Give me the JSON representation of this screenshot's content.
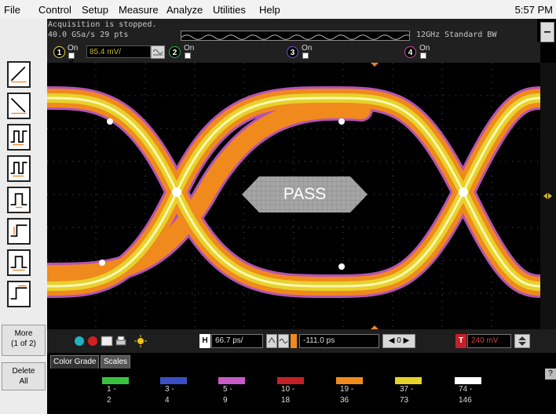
{
  "menu": {
    "items": [
      "File",
      "Control",
      "Setup",
      "Measure",
      "Analyze",
      "Utilities",
      "Help"
    ],
    "clock": "5:57 PM"
  },
  "status": {
    "line1": "Acquisition is stopped.",
    "line2": "40.0 GSa/s  29 pts",
    "bandwidth": "12GHz Standard BW",
    "minus_label": "–"
  },
  "channels": [
    {
      "num": "1",
      "on_label": "On",
      "color": "#e8d84a",
      "scale": "85.4 mV/"
    },
    {
      "num": "2",
      "on_label": "On",
      "color": "#2bb54b"
    },
    {
      "num": "3",
      "on_label": "On",
      "color": "#7a4fd0"
    },
    {
      "num": "4",
      "on_label": "On",
      "color": "#d04fa8"
    }
  ],
  "sidebar": {
    "more_label": "More",
    "more_page": "(1 of 2)",
    "delete_label": "Delete",
    "delete_label2": "All"
  },
  "display": {
    "mask_result": "PASS"
  },
  "controls": {
    "h_tag": "H",
    "time_per_div": "66.7 ps/",
    "delay": "-111.0 ps",
    "ref_label": "0",
    "t_tag": "T",
    "trigger_level": "240 mV"
  },
  "tabs": [
    "Color Grade",
    "Scales"
  ],
  "color_grade": {
    "legend": [
      {
        "color": "#39c240",
        "top": "1 -",
        "bottom": "2"
      },
      {
        "color": "#3a4fc6",
        "top": "3 -",
        "bottom": "4"
      },
      {
        "color": "#c85cc8",
        "top": "5 -",
        "bottom": "9"
      },
      {
        "color": "#c42027",
        "top": "10 -",
        "bottom": "18"
      },
      {
        "color": "#f08a1c",
        "top": "19 -",
        "bottom": "36"
      },
      {
        "color": "#e6d22c",
        "top": "37 -",
        "bottom": "73"
      },
      {
        "color": "#ffffff",
        "top": "74 -",
        "bottom": "146"
      }
    ]
  },
  "help_label": "?"
}
